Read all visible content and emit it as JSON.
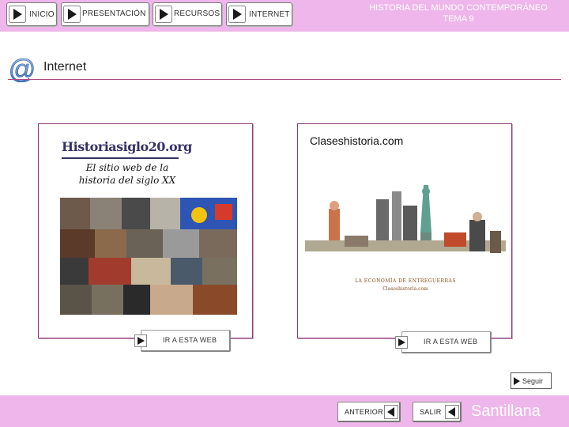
{
  "nav": {
    "inicio": "INICIO",
    "presentacion": "PRESENTACIÓN",
    "recursos": "RECURSOS",
    "internet": "INTERNET"
  },
  "header": {
    "line1": "HISTORIA DEL MUNDO CONTEMPORÁNEO",
    "line2": "TEMA 9"
  },
  "section": {
    "title": "Internet",
    "icon": "at-sign-icon"
  },
  "cards": [
    {
      "logo_text": "Historiasiglo20.org",
      "tagline_line1": "El sitio web de la",
      "tagline_line2": "historia del siglo XX",
      "button_label": "IR A ESTA WEB"
    },
    {
      "title": "Claseshistoria.com",
      "caption": "LA ECONOMÍA DE ENTREGUERRAS",
      "caption_url": "Claseshistoria.com",
      "button_label": "IR A ESTA WEB"
    }
  ],
  "seguir": "Seguir",
  "footer": {
    "anterior": "ANTERIOR",
    "salir": "SALIR",
    "brand": "Santillana"
  },
  "colors": {
    "bar": "#eeb6ea",
    "accent": "#8b3a78",
    "play_fill": "#1a1a1a"
  }
}
